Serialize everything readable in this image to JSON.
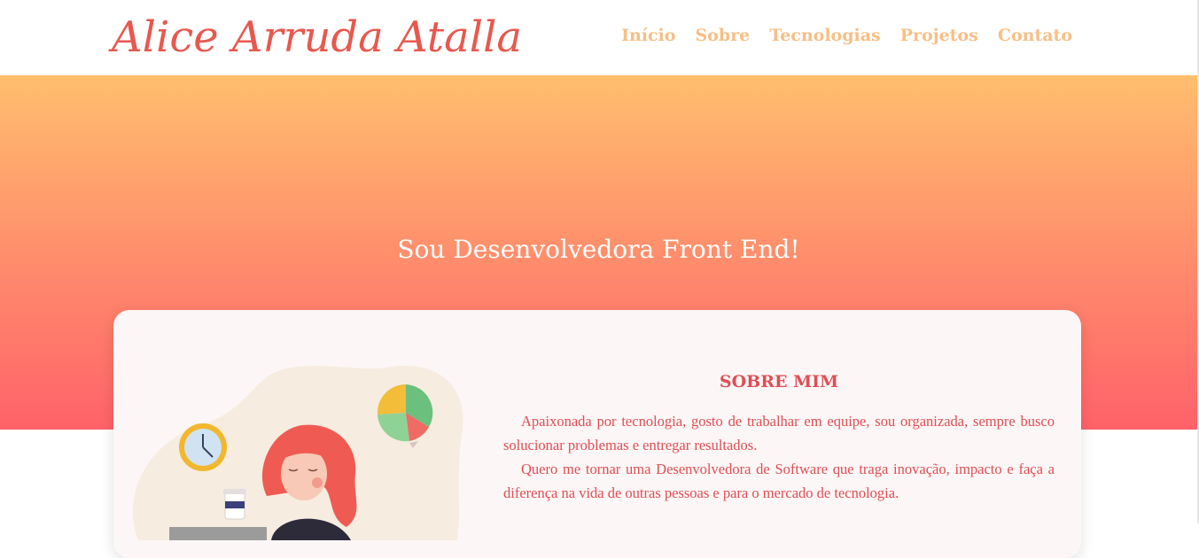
{
  "header": {
    "logo_text": "Alice Arruda Atalla",
    "nav": [
      "Início",
      "Sobre",
      "Tecnologias",
      "Projetos",
      "Contato"
    ]
  },
  "hero": {
    "title": "Sou Desenvolvedora Front End!"
  },
  "about": {
    "title": "SOBRE MIM",
    "paragraphs": [
      "Apaixonada por tecnologia, gosto de trabalhar em equipe, sou organizada, sempre busco solucionar problemas e entregar resultados.",
      "Quero me tornar uma Desenvolvedora de Software que traga inovação, impacto e faça a diferença na vida de outras pessoas e para o mercado de tecnologia."
    ]
  },
  "colors": {
    "accent": "#e8584e",
    "nav": "#f7bf86",
    "gradient_top": "#ffbe6e",
    "gradient_bottom": "#ff6269",
    "card_bg": "#fcf6f6"
  },
  "icons": [
    "clock-icon",
    "pie-chart-icon",
    "coffee-cup-icon"
  ]
}
